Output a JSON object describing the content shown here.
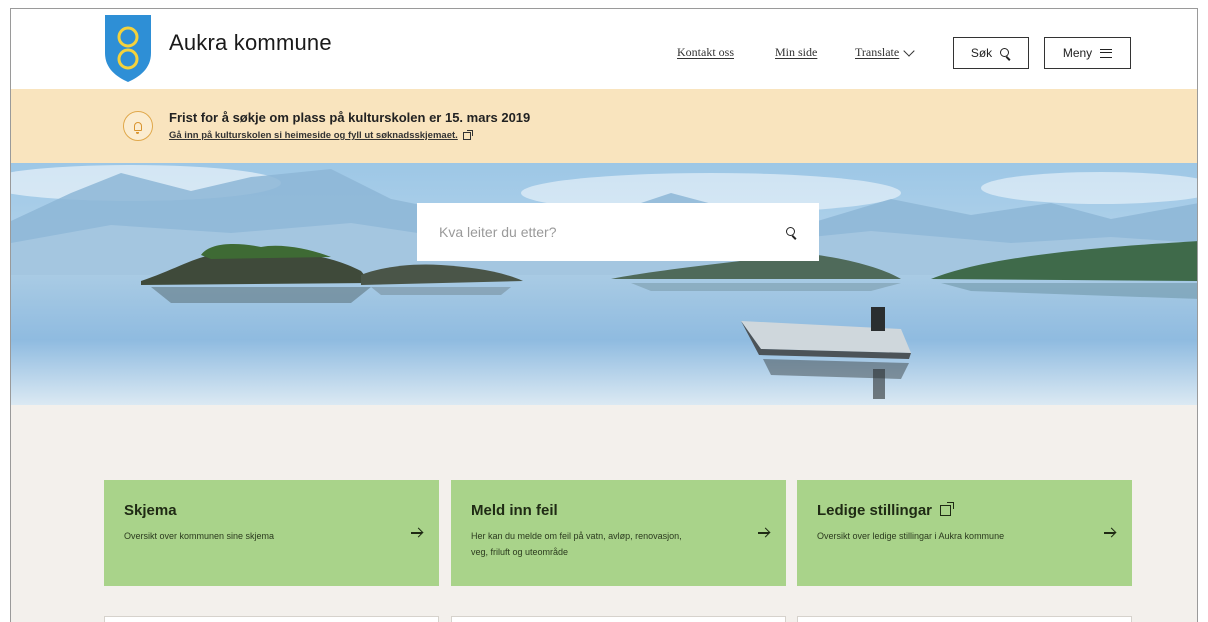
{
  "header": {
    "brand": "Aukra kommune",
    "nav": {
      "contact": "Kontakt oss",
      "my_page": "Min side",
      "translate": "Translate"
    },
    "search_button": "Søk",
    "menu_button": "Meny"
  },
  "alert": {
    "title": "Frist for å søkje om plass på kulturskolen er 15. mars 2019",
    "link": "Gå inn på kulturskolen si heimeside og fyll ut søknadsskjemaet."
  },
  "hero": {
    "search_placeholder": "Kva leiter du etter?"
  },
  "cards": [
    {
      "title": "Skjema",
      "description": "Oversikt over kommunen sine skjema",
      "external": false
    },
    {
      "title": "Meld inn feil",
      "description": "Her kan du melde om feil på vatn, avløp, renovasjon, veg, friluft og uteområde",
      "external": false
    },
    {
      "title": "Ledige stillingar",
      "description": "Oversikt over ledige stillingar i Aukra kommune",
      "external": true
    }
  ],
  "colors": {
    "alert_bg": "#f9e4be",
    "card_bg": "#a9d38a",
    "page_bg": "#f3f0ec",
    "logo_blue": "#2e8fd6",
    "logo_yellow": "#f4d23c"
  },
  "icons": {
    "logo": "coat-of-arms-icon",
    "alert": "bell-icon",
    "search": "search-icon",
    "menu": "hamburger-icon",
    "external": "external-link-icon",
    "arrow": "arrow-right-icon"
  }
}
